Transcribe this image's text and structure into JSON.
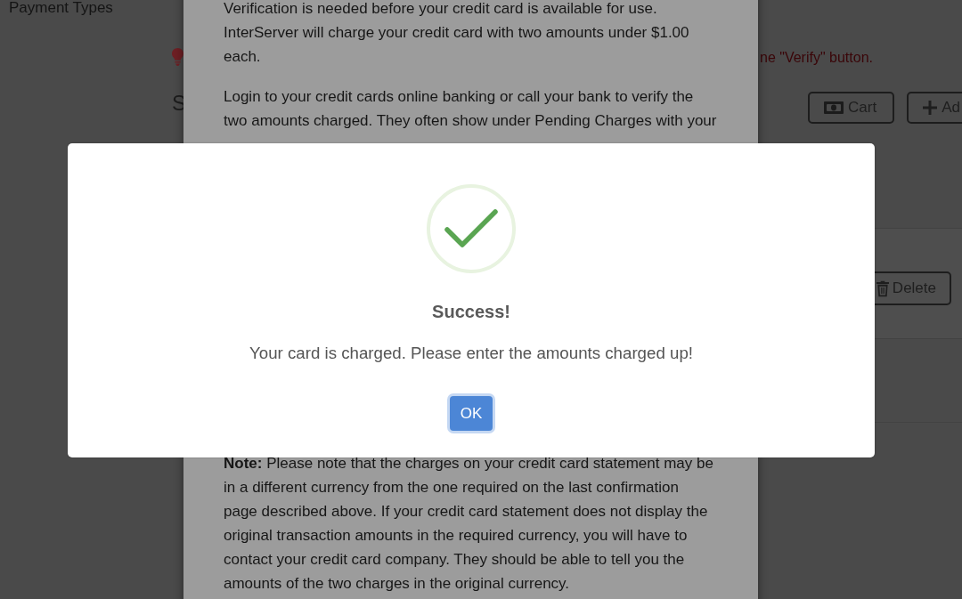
{
  "sidebar": {
    "items": [
      {
        "label": "Payment Types"
      }
    ]
  },
  "main": {
    "alert": {
      "text": "ne \"Verify\" button."
    },
    "heading": "S",
    "toolbar_buttons": [
      {
        "kind": "cart",
        "label": "Cart"
      },
      {
        "kind": "add",
        "label": "Ad"
      }
    ],
    "row_actions": [
      {
        "kind": "delete",
        "label": "Delete"
      }
    ]
  },
  "verification_dialog": {
    "paragraphs": [
      {
        "lines": [
          "Verification is needed before your credit card is available for use.",
          "InterServer will charge your credit card with two amounts under $1.00",
          "each."
        ]
      },
      {
        "lines": [
          "Login to your credit cards online banking or call your bank to verify the",
          "two amounts charged. They often show under Pending Charges with your"
        ]
      }
    ],
    "note": {
      "lines": [
        "**Note:** Please note that the charges on your credit card statement may be",
        "in a different currency from the one required on the last confirmation",
        "page described above. If your credit card statement does not display the",
        "original transaction amounts in the required currency, you will have to",
        "contact your credit card company. They should be able to tell you the",
        "amounts of the two charges in the original currency."
      ]
    }
  },
  "success_dialog": {
    "title": "Success!",
    "message": "Your card is charged. Please enter the amounts charged up!",
    "button": {
      "label": "OK",
      "focused": true
    }
  }
}
